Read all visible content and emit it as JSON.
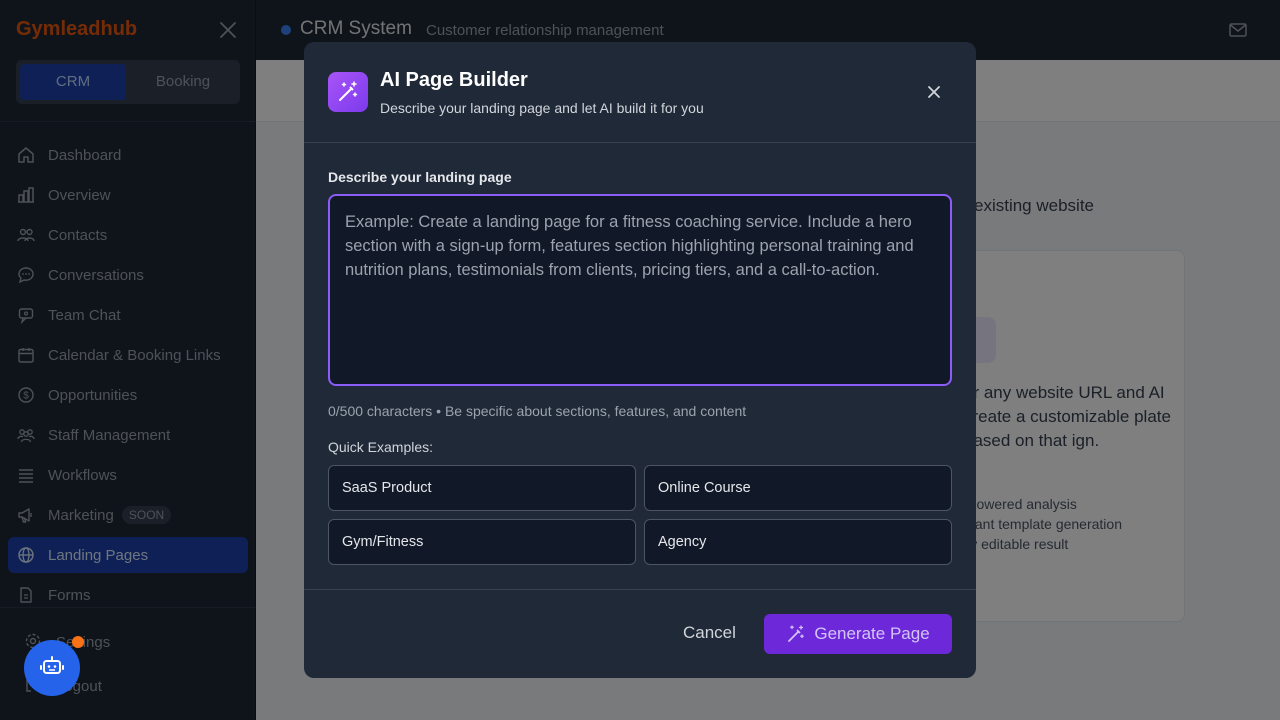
{
  "sidebar": {
    "brand": "Gymleadhub",
    "switcher": {
      "crm": "CRM",
      "booking": "Booking"
    },
    "items": [
      {
        "label": "Dashboard",
        "icon": "home-icon"
      },
      {
        "label": "Overview",
        "icon": "bar-chart-icon"
      },
      {
        "label": "Contacts",
        "icon": "users-icon"
      },
      {
        "label": "Conversations",
        "icon": "chat-icon"
      },
      {
        "label": "Team Chat",
        "icon": "team-chat-icon"
      },
      {
        "label": "Calendar & Booking Links",
        "icon": "calendar-icon"
      },
      {
        "label": "Opportunities",
        "icon": "dollar-icon"
      },
      {
        "label": "Staff Management",
        "icon": "staff-icon"
      },
      {
        "label": "Workflows",
        "icon": "list-icon"
      },
      {
        "label": "Marketing",
        "icon": "megaphone-icon",
        "badge": "SOON"
      },
      {
        "label": "Landing Pages",
        "icon": "globe-icon",
        "active": true
      },
      {
        "label": "Forms",
        "icon": "document-icon"
      }
    ],
    "settings": "Settings",
    "logout": "Logout"
  },
  "topbar": {
    "title": "CRM System",
    "subtitle": "Customer relationship management"
  },
  "background": {
    "text": "existing website",
    "card_desc": "er any website URL and AI create a customizable plate based on that ign.",
    "features": [
      "-powered analysis",
      "stant template generation",
      "lly editable result"
    ]
  },
  "modal": {
    "title": "AI Page Builder",
    "subtitle": "Describe your landing page and let AI build it for you",
    "label": "Describe your landing page",
    "placeholder": "Example: Create a landing page for a fitness coaching service. Include a hero section with a sign-up form, features section highlighting personal training and nutrition plans, testimonials from clients, pricing tiers, and a call-to-action.",
    "value": "",
    "count": "0/500 characters • Be specific about sections, features, and content",
    "quick_examples_label": "Quick Examples:",
    "quick_examples": [
      "SaaS Product",
      "Online Course",
      "Gym/Fitness",
      "Agency"
    ],
    "cancel": "Cancel",
    "generate": "Generate Page"
  },
  "colors": {
    "accent": "#8b5cf6",
    "brand": "#ea580c",
    "active_nav": "#1e40af"
  }
}
